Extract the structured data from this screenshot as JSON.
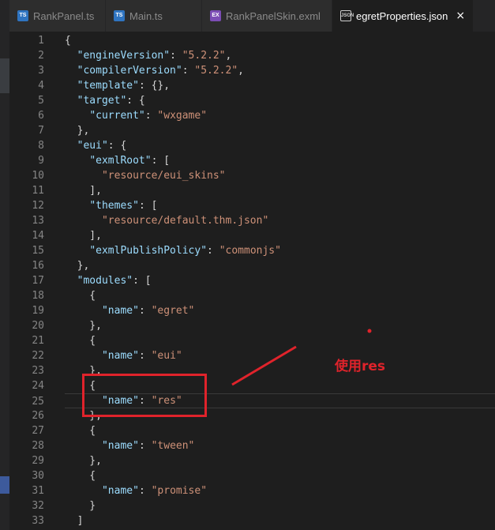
{
  "tabs": [
    {
      "label": "RankPanel.ts",
      "icon": "typescript-file-icon",
      "active": false
    },
    {
      "label": "Main.ts",
      "icon": "typescript-file-icon",
      "active": false
    },
    {
      "label": "RankPanelSkin.exml",
      "icon": "exml-file-icon",
      "active": false
    },
    {
      "label": "egretProperties.json",
      "icon": "json-file-icon",
      "active": true
    }
  ],
  "close_icon": "×",
  "lines": [
    {
      "n": "1",
      "tokens": [
        [
          "p",
          "{"
        ]
      ]
    },
    {
      "n": "2",
      "tokens": [
        [
          "p",
          "  "
        ],
        [
          "k",
          "\"engineVersion\""
        ],
        [
          "p",
          ": "
        ],
        [
          "s",
          "\"5.2.2\""
        ],
        [
          "p",
          ","
        ]
      ]
    },
    {
      "n": "3",
      "tokens": [
        [
          "p",
          "  "
        ],
        [
          "k",
          "\"compilerVersion\""
        ],
        [
          "p",
          ": "
        ],
        [
          "s",
          "\"5.2.2\""
        ],
        [
          "p",
          ","
        ]
      ]
    },
    {
      "n": "4",
      "tokens": [
        [
          "p",
          "  "
        ],
        [
          "k",
          "\"template\""
        ],
        [
          "p",
          ": {},"
        ]
      ]
    },
    {
      "n": "5",
      "tokens": [
        [
          "p",
          "  "
        ],
        [
          "k",
          "\"target\""
        ],
        [
          "p",
          ": {"
        ]
      ]
    },
    {
      "n": "6",
      "tokens": [
        [
          "p",
          "    "
        ],
        [
          "k",
          "\"current\""
        ],
        [
          "p",
          ": "
        ],
        [
          "s",
          "\"wxgame\""
        ]
      ]
    },
    {
      "n": "7",
      "tokens": [
        [
          "p",
          "  },"
        ]
      ]
    },
    {
      "n": "8",
      "tokens": [
        [
          "p",
          "  "
        ],
        [
          "k",
          "\"eui\""
        ],
        [
          "p",
          ": {"
        ]
      ]
    },
    {
      "n": "9",
      "tokens": [
        [
          "p",
          "    "
        ],
        [
          "k",
          "\"exmlRoot\""
        ],
        [
          "p",
          ": ["
        ]
      ]
    },
    {
      "n": "10",
      "tokens": [
        [
          "p",
          "      "
        ],
        [
          "s",
          "\"resource/eui_skins\""
        ]
      ]
    },
    {
      "n": "11",
      "tokens": [
        [
          "p",
          "    ],"
        ]
      ]
    },
    {
      "n": "12",
      "tokens": [
        [
          "p",
          "    "
        ],
        [
          "k",
          "\"themes\""
        ],
        [
          "p",
          ": ["
        ]
      ]
    },
    {
      "n": "13",
      "tokens": [
        [
          "p",
          "      "
        ],
        [
          "s",
          "\"resource/default.thm.json\""
        ]
      ]
    },
    {
      "n": "14",
      "tokens": [
        [
          "p",
          "    ],"
        ]
      ]
    },
    {
      "n": "15",
      "tokens": [
        [
          "p",
          "    "
        ],
        [
          "k",
          "\"exmlPublishPolicy\""
        ],
        [
          "p",
          ": "
        ],
        [
          "s",
          "\"commonjs\""
        ]
      ]
    },
    {
      "n": "16",
      "tokens": [
        [
          "p",
          "  },"
        ]
      ]
    },
    {
      "n": "17",
      "tokens": [
        [
          "p",
          "  "
        ],
        [
          "k",
          "\"modules\""
        ],
        [
          "p",
          ": ["
        ]
      ]
    },
    {
      "n": "18",
      "tokens": [
        [
          "p",
          "    {"
        ]
      ]
    },
    {
      "n": "19",
      "tokens": [
        [
          "p",
          "      "
        ],
        [
          "k",
          "\"name\""
        ],
        [
          "p",
          ": "
        ],
        [
          "s",
          "\"egret\""
        ]
      ]
    },
    {
      "n": "20",
      "tokens": [
        [
          "p",
          "    },"
        ]
      ]
    },
    {
      "n": "21",
      "tokens": [
        [
          "p",
          "    {"
        ]
      ]
    },
    {
      "n": "22",
      "tokens": [
        [
          "p",
          "      "
        ],
        [
          "k",
          "\"name\""
        ],
        [
          "p",
          ": "
        ],
        [
          "s",
          "\"eui\""
        ]
      ]
    },
    {
      "n": "23",
      "tokens": [
        [
          "p",
          "    },"
        ]
      ]
    },
    {
      "n": "24",
      "tokens": [
        [
          "p",
          "    {"
        ]
      ]
    },
    {
      "n": "25",
      "tokens": [
        [
          "p",
          "      "
        ],
        [
          "k",
          "\"name\""
        ],
        [
          "p",
          ": "
        ],
        [
          "s",
          "\"res\""
        ]
      ]
    },
    {
      "n": "26",
      "tokens": [
        [
          "p",
          "    },"
        ]
      ]
    },
    {
      "n": "27",
      "tokens": [
        [
          "p",
          "    {"
        ]
      ]
    },
    {
      "n": "28",
      "tokens": [
        [
          "p",
          "      "
        ],
        [
          "k",
          "\"name\""
        ],
        [
          "p",
          ": "
        ],
        [
          "s",
          "\"tween\""
        ]
      ]
    },
    {
      "n": "29",
      "tokens": [
        [
          "p",
          "    },"
        ]
      ]
    },
    {
      "n": "30",
      "tokens": [
        [
          "p",
          "    {"
        ]
      ]
    },
    {
      "n": "31",
      "tokens": [
        [
          "p",
          "      "
        ],
        [
          "k",
          "\"name\""
        ],
        [
          "p",
          ": "
        ],
        [
          "s",
          "\"promise\""
        ]
      ]
    },
    {
      "n": "32",
      "tokens": [
        [
          "p",
          "    }"
        ]
      ]
    },
    {
      "n": "33",
      "tokens": [
        [
          "p",
          "  ]"
        ]
      ]
    }
  ],
  "active_line": "25",
  "annotation": {
    "text": "使用res",
    "color": "#e0232b"
  },
  "colors": {
    "key": "#9cdcfe",
    "string": "#ce9178",
    "punct": "#d4d4d4",
    "line_number": "#858585",
    "background": "#1e1e1e"
  }
}
